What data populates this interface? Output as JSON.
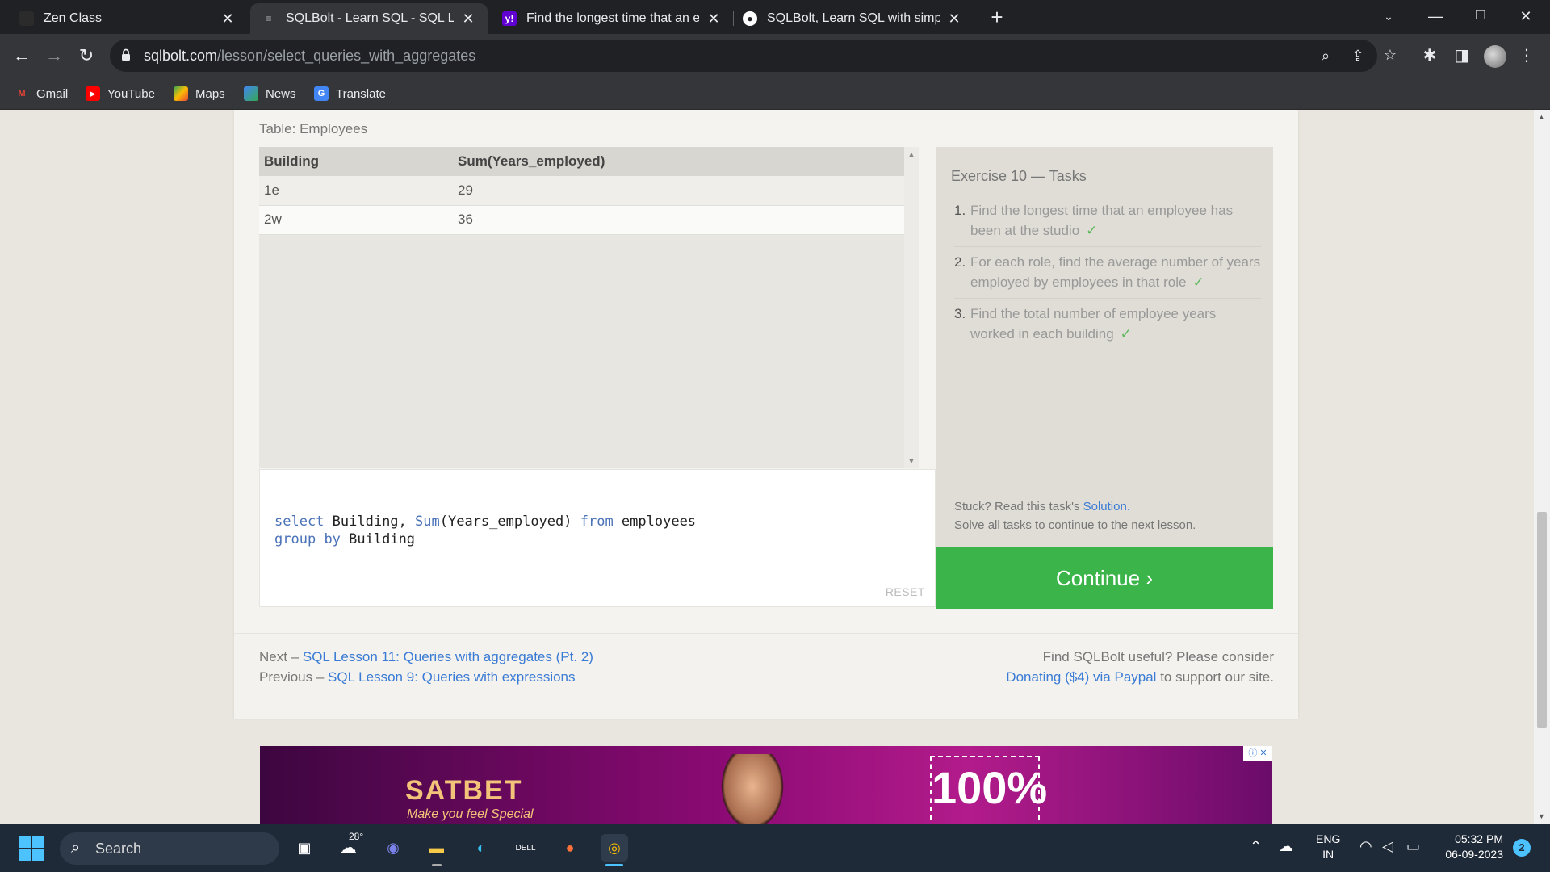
{
  "browser": {
    "tabs": [
      {
        "title": "Zen Class",
        "icon": "zen-class-icon"
      },
      {
        "title": "SQLBolt - Learn SQL - SQL Lesson",
        "icon": "sqlbolt-icon"
      },
      {
        "title": "Find the longest time that an em",
        "icon": "yahoo-icon"
      },
      {
        "title": "SQLBolt, Learn SQL with simple, i",
        "icon": "github-icon"
      }
    ],
    "url_host": "sqlbolt.com",
    "url_path": "/lesson/select_queries_with_aggregates",
    "bookmarks": [
      "Gmail",
      "YouTube",
      "Maps",
      "News",
      "Translate"
    ]
  },
  "page": {
    "table_caption": "Table: Employees",
    "result": {
      "headers": [
        "Building",
        "Sum(Years_employed)"
      ],
      "rows": [
        [
          "1e",
          "29"
        ],
        [
          "2w",
          "36"
        ]
      ]
    },
    "tasks": {
      "title": "Exercise 10 — Tasks",
      "items": [
        {
          "num": "1.",
          "text": "Find the longest time that an employee has been at the studio",
          "check": "✓"
        },
        {
          "num": "2.",
          "text": "For each role, find the average number of years employed by employees in that role",
          "check": "✓"
        },
        {
          "num": "3.",
          "text": "Find the total number of employee years worked in each building",
          "check": "✓"
        }
      ],
      "stuck_prefix": "Stuck? Read this task's ",
      "solution_link": "Solution.",
      "solve_all": "Solve all tasks to continue to the next lesson."
    },
    "editor": {
      "kw_select": "select",
      "line1_a": " Building, ",
      "kw_sum": "Sum",
      "line1_b": "(Years_employed) ",
      "kw_from": "from",
      "line1_c": " employees",
      "kw_group": "group",
      "kw_by": "by",
      "line2_c": " Building",
      "reset_label": "RESET"
    },
    "continue_label": "Continue ›",
    "footer": {
      "next_prefix": "Next – ",
      "next_link": "SQL Lesson 11: Queries with aggregates (Pt. 2)",
      "prev_prefix": "Previous – ",
      "prev_link": "SQL Lesson 9: Queries with expressions",
      "donate_text1": "Find SQLBolt useful? Please consider",
      "donate_link": "Donating ($4) via Paypal",
      "donate_text2": " to support our site."
    },
    "ad": {
      "brand": "SATBET",
      "tagline": "Make you feel Special",
      "offer": "100%"
    }
  },
  "taskbar": {
    "search_label": "Search",
    "weather_temp": "28°",
    "lang_line1": "ENG",
    "lang_line2": "IN",
    "time": "05:32 PM",
    "date": "06-09-2023",
    "notifications": "2"
  }
}
